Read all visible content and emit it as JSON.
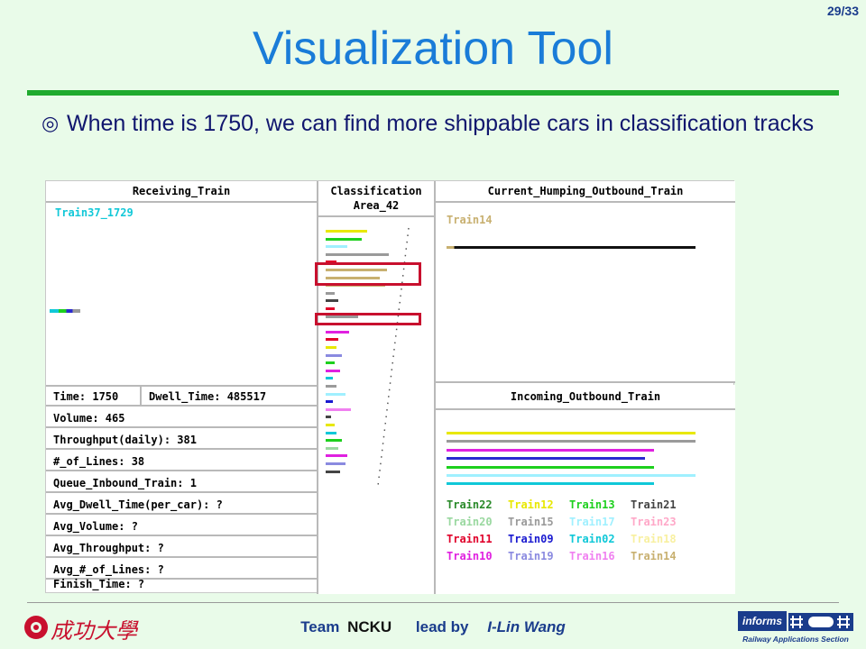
{
  "slide": {
    "page_number": "29/33",
    "title": "Visualization Tool",
    "bullet_mark": "◎",
    "bullet_text": "When time is 1750, we can find more shippable cars in classification tracks"
  },
  "tool": {
    "receiving": {
      "header": "Receiving_Train",
      "train_label": "Train37_1729"
    },
    "classification": {
      "header_line1": "Classification",
      "header_line2": "Area_42"
    },
    "humping": {
      "header": "Current_Humping_Outbound_Train",
      "train_label": "Train14"
    },
    "incoming": {
      "header": "Incoming_Outbound_Train"
    },
    "stats": {
      "time": "Time: 1750",
      "dwell": "Dwell_Time: 485517",
      "volume": "Volume:  465",
      "throughput": "Throughput(daily): 381",
      "lines": "#_of_Lines: 38",
      "queue": "Queue_Inbound_Train: 1",
      "avg_dwell": "Avg_Dwell_Time(per_car): ?",
      "avg_volume": "Avg_Volume:  ?",
      "avg_throughput": "Avg_Throughput:  ?",
      "avg_lines": "Avg_#_of_Lines:  ?",
      "finish": "Finish_Time:  ?"
    },
    "legend": [
      [
        {
          "name": "Train22",
          "color": "#2a8a2a"
        },
        {
          "name": "Train12",
          "color": "#e8e800"
        },
        {
          "name": "Train13",
          "color": "#1ed01e"
        },
        {
          "name": "Train21",
          "color": "#444444"
        }
      ],
      [
        {
          "name": "Train20",
          "color": "#9ad8a0"
        },
        {
          "name": "Train15",
          "color": "#9a9a9a"
        },
        {
          "name": "Train17",
          "color": "#a0f0ff"
        },
        {
          "name": "Train23",
          "color": "#ffa8c8"
        }
      ],
      [
        {
          "name": "Train11",
          "color": "#e0002a"
        },
        {
          "name": "Train09",
          "color": "#1a1ad0"
        },
        {
          "name": "Train02",
          "color": "#10c8d8"
        },
        {
          "name": "Train18",
          "color": "#f8f0a0"
        }
      ],
      [
        {
          "name": "Train10",
          "color": "#e020e0"
        },
        {
          "name": "Train19",
          "color": "#8a8ae0"
        },
        {
          "name": "Train16",
          "color": "#f080f0"
        },
        {
          "name": "Train14",
          "color": "#c8b070"
        }
      ]
    ]
  },
  "footer": {
    "team": "Team",
    "ncku": "NCKU",
    "lead": "lead by",
    "name": "I-Lin Wang",
    "logo_left_text": "成功大學",
    "logo_right_text": "Railway Applications Section",
    "logo_right_brand": "informs"
  }
}
